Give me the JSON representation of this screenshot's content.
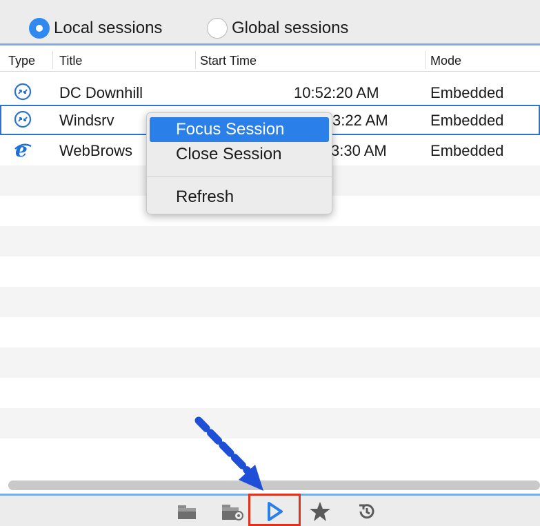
{
  "radio": {
    "local_label": "Local sessions",
    "global_label": "Global sessions",
    "selected": "local"
  },
  "table": {
    "columns": [
      "Type",
      "Title",
      "Start Time",
      "Mode"
    ],
    "rows": [
      {
        "type_icon": "remote-desktop-icon",
        "title": "DC Downhill",
        "start": "10:52:20 AM",
        "mode": "Embedded"
      },
      {
        "type_icon": "remote-desktop-icon",
        "title": "Windsrv",
        "start": "3:22 AM",
        "mode": "Embedded"
      },
      {
        "type_icon": "internet-explorer-icon",
        "title": "WebBrows",
        "start": "3:30 AM",
        "mode": "Embedded"
      }
    ]
  },
  "context_menu": {
    "items": [
      "Focus Session",
      "Close Session",
      "Refresh"
    ],
    "highlighted": "Focus Session"
  },
  "toolbar": {
    "icons": [
      "folder-icon",
      "folder-settings-icon",
      "play-icon",
      "star-icon",
      "history-icon"
    ]
  },
  "colors": {
    "accent": "#2a7fe8",
    "annotation_arrow": "#1f4fd6",
    "annotation_box": "#e0311e"
  }
}
